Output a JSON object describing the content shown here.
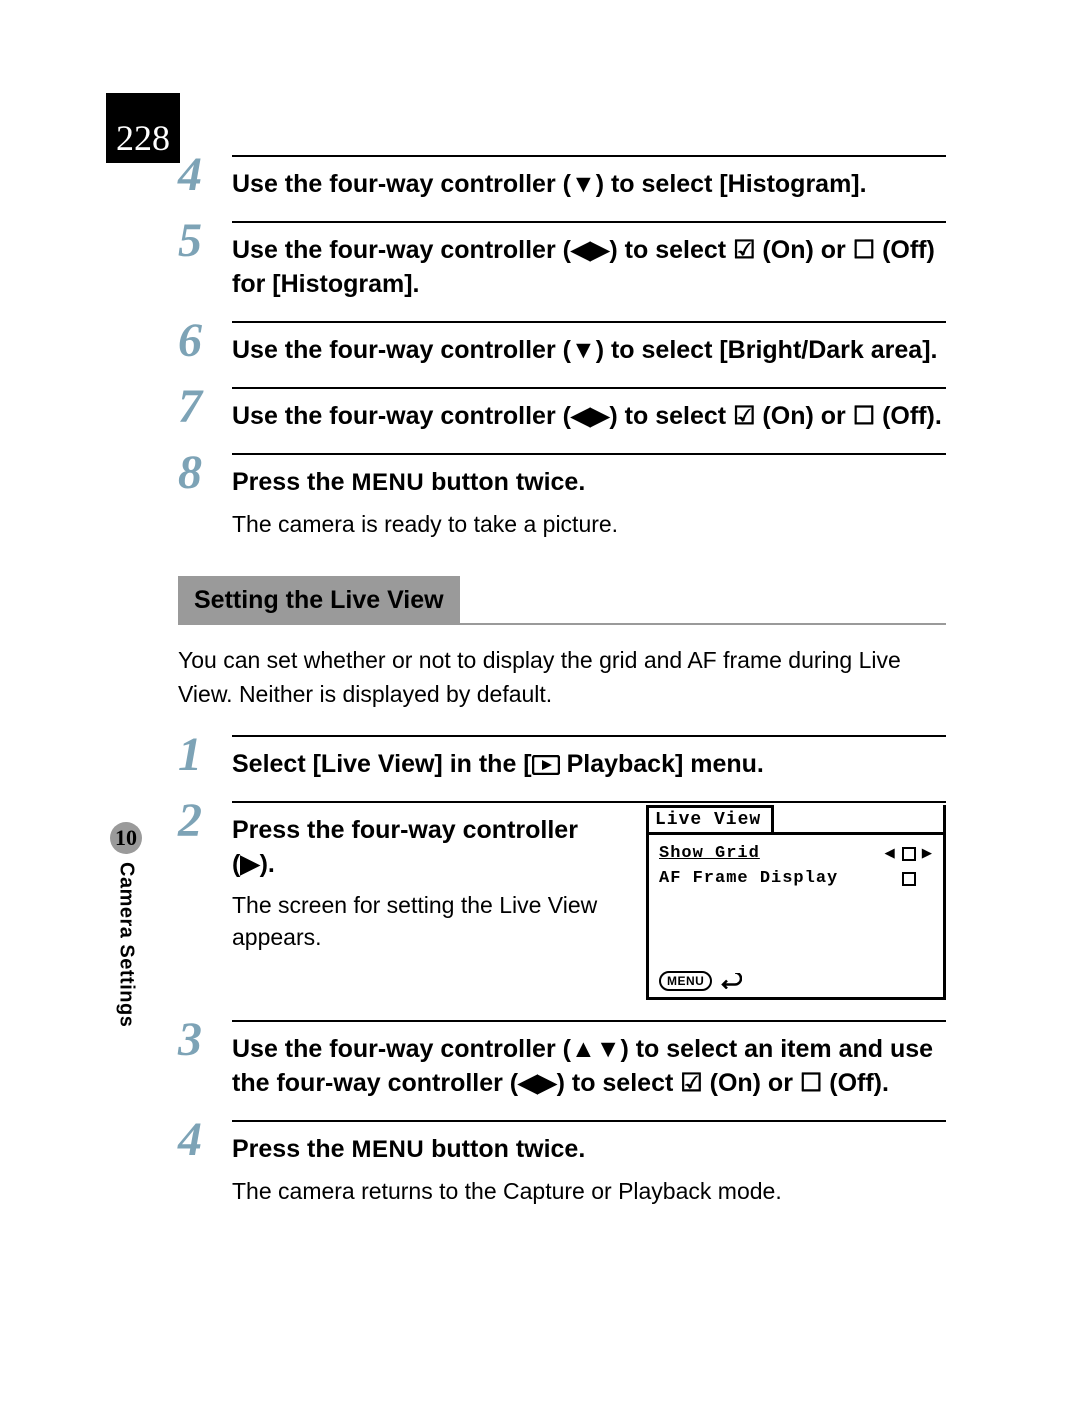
{
  "page_number": "228",
  "chapter": {
    "number": "10",
    "title": "Camera Settings"
  },
  "menu_label": "MENU",
  "steps_a": [
    {
      "num": "4",
      "title_parts": [
        "Use the four-way controller (",
        "▼",
        ") to select [Histogram]."
      ]
    },
    {
      "num": "5",
      "title_parts": [
        "Use the four-way controller (",
        "◀▶",
        ") to select ",
        "☑",
        " (On) or ",
        "☐",
        " (Off) for [Histogram]."
      ]
    },
    {
      "num": "6",
      "title_parts": [
        "Use the four-way controller (",
        "▼",
        ") to select [Bright/Dark area]."
      ]
    },
    {
      "num": "7",
      "title_parts": [
        "Use the four-way controller (",
        "◀▶",
        ") to select ",
        "☑",
        " (On) or ",
        "☐",
        " (Off)."
      ]
    },
    {
      "num": "8",
      "title_parts": [
        "Press the ",
        "MENU",
        " button twice."
      ],
      "desc": "The camera is ready to take a picture."
    }
  ],
  "section": {
    "heading": "Setting the Live View",
    "intro": "You can set whether or not to display the grid and AF frame during Live View. Neither is displayed by default."
  },
  "steps_b": [
    {
      "num": "1",
      "title_parts": [
        "Select [Live View] in the [",
        "▶",
        " Playback] menu."
      ]
    },
    {
      "num": "2",
      "title_parts": [
        "Press the four-way controller (",
        "▶",
        ")."
      ],
      "desc": "The screen for setting the Live View appears.",
      "lcd": {
        "title": "Live View",
        "rows": [
          {
            "label": "Show Grid",
            "selected": true,
            "nav": true
          },
          {
            "label": "AF Frame Display",
            "selected": false,
            "nav": false
          }
        ],
        "footer_menu": "MENU"
      }
    },
    {
      "num": "3",
      "title_parts": [
        "Use the four-way controller (",
        "▲▼",
        ") to select an item and use the four-way controller (",
        "◀▶",
        ") to select ",
        "☑",
        " (On) or ",
        "☐",
        " (Off)."
      ]
    },
    {
      "num": "4",
      "title_parts": [
        "Press the ",
        "MENU",
        " button twice."
      ],
      "desc": "The camera returns to the Capture or Playback mode."
    }
  ]
}
